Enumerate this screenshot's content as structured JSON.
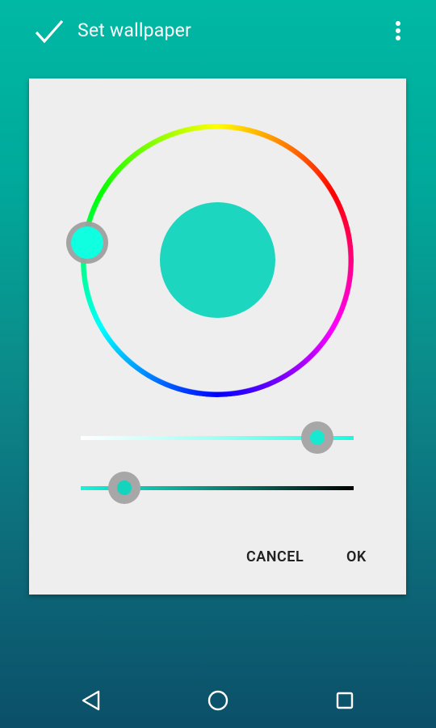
{
  "appbar": {
    "title": "Set wallpaper",
    "confirm_icon": "check-icon",
    "overflow_icon": "more-vert-icon"
  },
  "color_picker": {
    "selected_color": "#1dd6bf",
    "wheel_knob_color": "#0fffe0",
    "saturation_level": 0.87,
    "value_level": 0.16
  },
  "dialog": {
    "cancel_label": "CANCEL",
    "ok_label": "OK"
  },
  "navigation": {
    "back_icon": "back-triangle-icon",
    "home_icon": "home-circle-icon",
    "recents_icon": "recents-square-icon"
  }
}
